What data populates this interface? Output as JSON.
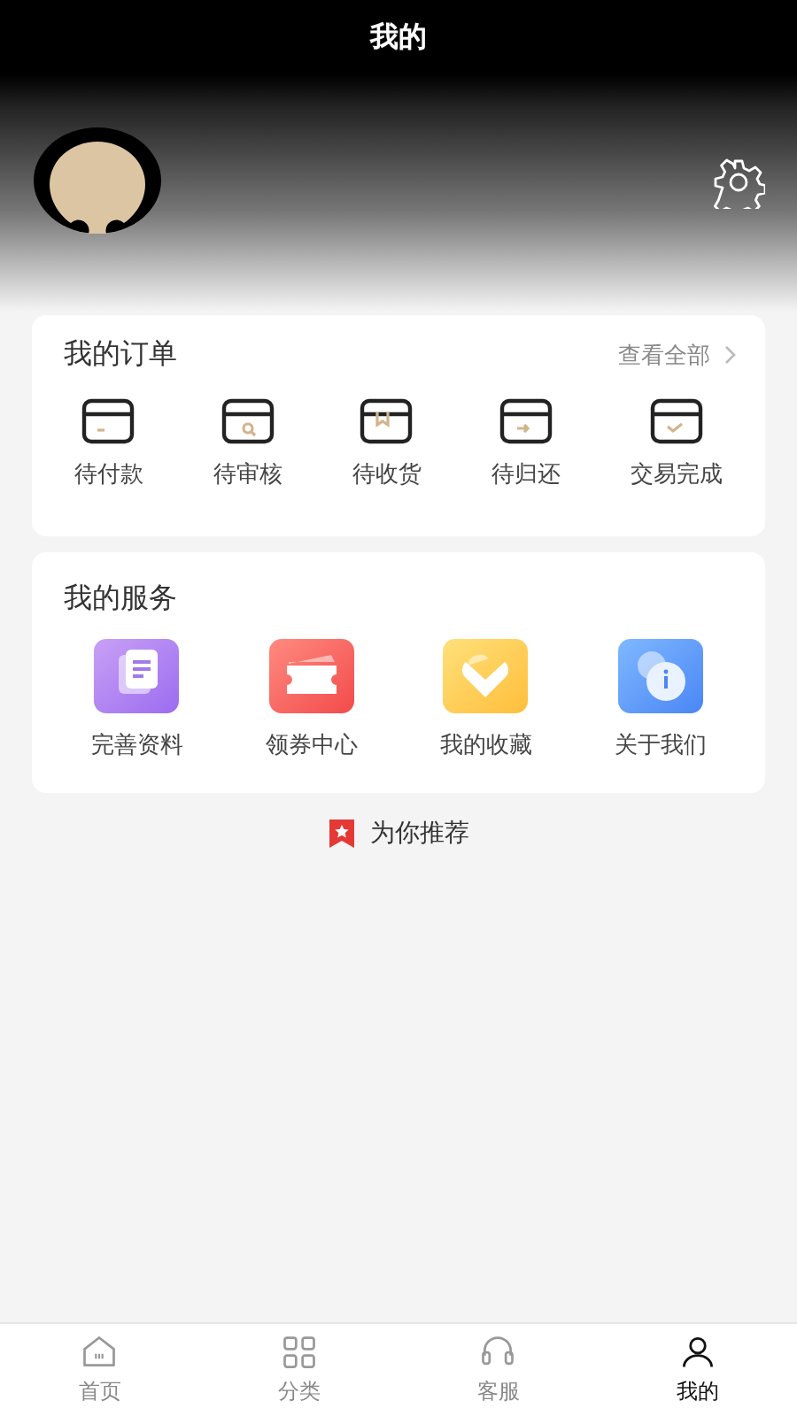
{
  "header": {
    "title": "我的"
  },
  "orders": {
    "title": "我的订单",
    "view_all": "查看全部",
    "items": [
      {
        "label": "待付款"
      },
      {
        "label": "待审核"
      },
      {
        "label": "待收货"
      },
      {
        "label": "待归还"
      },
      {
        "label": "交易完成"
      }
    ]
  },
  "services": {
    "title": "我的服务",
    "items": [
      {
        "label": "完善资料"
      },
      {
        "label": "领券中心"
      },
      {
        "label": "我的收藏"
      },
      {
        "label": "关于我们"
      }
    ]
  },
  "recommend": {
    "label": "为你推荐"
  },
  "tab_bar": [
    {
      "label": "首页",
      "selected": false
    },
    {
      "label": "分类",
      "selected": false
    },
    {
      "label": "客服",
      "selected": false
    },
    {
      "label": "我的",
      "selected": true
    }
  ]
}
